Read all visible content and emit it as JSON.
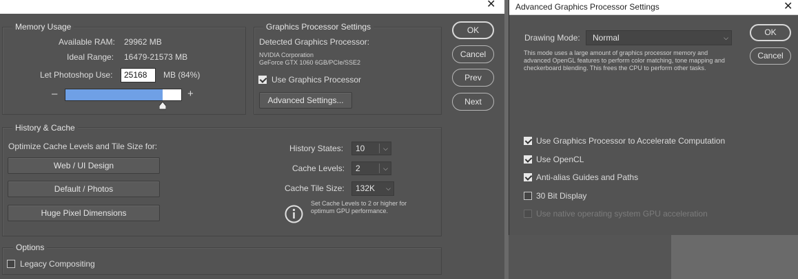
{
  "preferences": {
    "memory": {
      "title": "Memory Usage",
      "available_ram_label": "Available RAM:",
      "available_ram_value": "29962 MB",
      "ideal_range_label": "Ideal Range:",
      "ideal_range_value": "16479-21573 MB",
      "let_use_label": "Let Photoshop Use:",
      "let_use_value": "25168",
      "let_use_unit": "MB (84%)",
      "minus": "–",
      "plus": "+",
      "slider_fraction": 0.84
    },
    "gpu": {
      "title": "Graphics Processor Settings",
      "detected_label": "Detected Graphics Processor:",
      "vendor": "NVIDIA Corporation",
      "model": "GeForce GTX 1060 6GB/PCIe/SSE2",
      "use_gpu_label": "Use Graphics Processor",
      "use_gpu_checked": true,
      "advanced_button": "Advanced Settings..."
    },
    "history": {
      "title": "History & Cache",
      "optimize_label": "Optimize Cache Levels and Tile Size for:",
      "presets": [
        "Web / UI Design",
        "Default / Photos",
        "Huge Pixel Dimensions"
      ],
      "history_states_label": "History States:",
      "history_states_value": "10",
      "cache_levels_label": "Cache Levels:",
      "cache_levels_value": "2",
      "cache_tile_label": "Cache Tile Size:",
      "cache_tile_value": "132K",
      "info_line1": "Set Cache Levels to 2 or higher for",
      "info_line2": "optimum GPU performance."
    },
    "options": {
      "title": "Options",
      "legacy_label": "Legacy Compositing",
      "legacy_checked": false
    },
    "buttons": {
      "ok": "OK",
      "cancel": "Cancel",
      "prev": "Prev",
      "next": "Next"
    }
  },
  "advanced": {
    "title": "Advanced Graphics Processor Settings",
    "drawing_mode_label": "Drawing Mode:",
    "drawing_mode_value": "Normal",
    "desc_line1": "This mode uses a large amount of graphics processor memory and",
    "desc_line2": "advanced OpenGL features to perform color matching, tone mapping and",
    "desc_line3": "checkerboard blending.  This frees the CPU to perform other tasks.",
    "ok": "OK",
    "cancel": "Cancel",
    "checks": [
      {
        "label": "Use Graphics Processor to Accelerate Computation",
        "checked": true,
        "enabled": true
      },
      {
        "label": "Use OpenCL",
        "checked": true,
        "enabled": true
      },
      {
        "label": "Anti-alias Guides and Paths",
        "checked": true,
        "enabled": true
      },
      {
        "label": "30 Bit Display",
        "checked": false,
        "enabled": true
      },
      {
        "label": "Use native operating system GPU acceleration",
        "checked": false,
        "enabled": false
      }
    ]
  },
  "icons": {
    "close": "close-icon",
    "info": "info-icon",
    "dropdown": "chevron-down-icon",
    "slider_thumb": "slider-thumb-icon"
  },
  "colors": {
    "panel": "#535353",
    "slider_fill": "#6fa0e6",
    "titlebar": "#ffffff"
  }
}
